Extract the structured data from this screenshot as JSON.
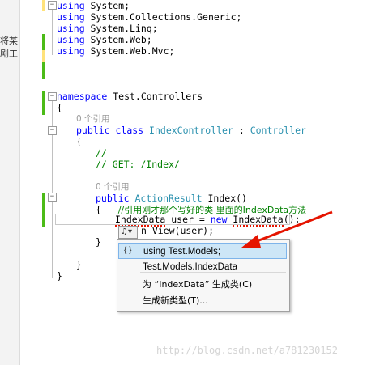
{
  "left_panel": {
    "text1": "将某",
    "text2": "剧工"
  },
  "code": {
    "using1": "using System;",
    "using2": "using System.Collections.Generic;",
    "using3": "using System.Linq;",
    "using4": "using System.Web;",
    "using5": "using System.Web.Mvc;",
    "ns_kw": "namespace",
    "ns_name": " Test.Controllers",
    "brace_open": "{",
    "ref_class": "0 个引用",
    "cls_public": "public",
    "cls_class": "class",
    "cls_name": "IndexController",
    "cls_colon": " : ",
    "cls_base": "Controller",
    "cls_brace_open": "{",
    "comment1": "//",
    "comment2": "// GET: /Index/",
    "ref_method": "0 个引用",
    "m_public": "public",
    "m_type": "ActionResult",
    "m_sig": " Index()",
    "m_brace_open": "{",
    "m_comment": "//引用刚才那个写好的类 里面的IndexData方法",
    "line_type": "IndexData",
    "line_rest": " user = ",
    "line_new": "new",
    "line_type2": "IndexData",
    "line_end": "();",
    "return_rest": "n View(user);",
    "m_brace_close": "}",
    "cls_brace_close": "}",
    "brace_close": "}"
  },
  "smart_tag": {
    "label": "♫▾"
  },
  "menu": {
    "item1": "using Test.Models;",
    "item2": "Test.Models.IndexData",
    "item3": "为 “IndexData” 生成类(C)",
    "item4": "生成新类型(T)...",
    "item1_icon": "{ }"
  },
  "watermark": "http://blog.csdn.net/a781230152",
  "colors": {
    "keyword": "#0000ff",
    "type": "#2b91af",
    "comment": "#008000",
    "arrow": "#e51400"
  }
}
